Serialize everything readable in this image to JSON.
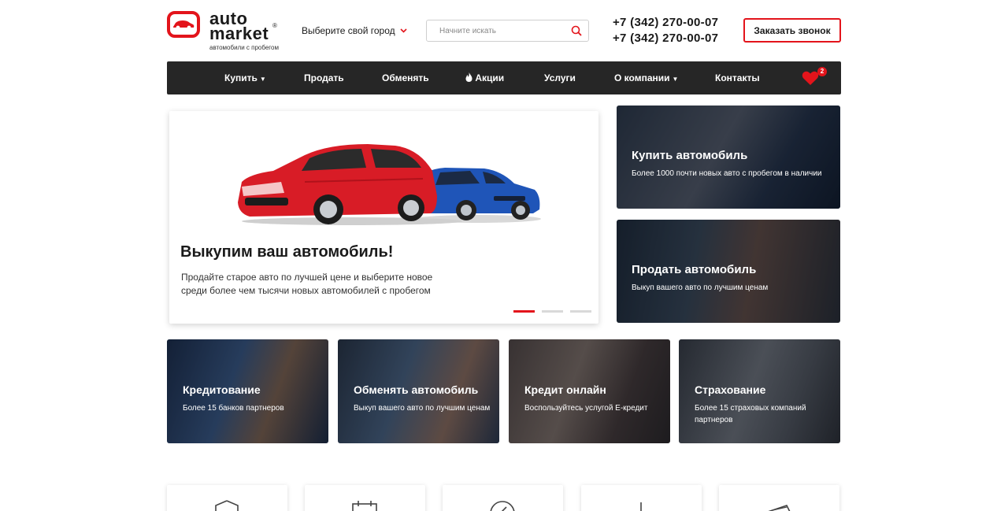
{
  "header": {
    "logo_line1": "auto",
    "logo_line2": "market",
    "logo_reg": "®",
    "tagline": "автомобили с пробегом",
    "city_label": "Выберите свой город",
    "search_placeholder": "Начните искать",
    "phone1": "+7 (342) 270-00-07",
    "phone2": "+7 (342) 270-00-07",
    "callback_label": "Заказать звонок"
  },
  "nav": {
    "items": [
      {
        "label": "Купить"
      },
      {
        "label": "Продать"
      },
      {
        "label": "Обменять"
      },
      {
        "label": "Акции"
      },
      {
        "label": "Услуги"
      },
      {
        "label": "О компании"
      },
      {
        "label": "Контакты"
      }
    ],
    "favorites_count": "2"
  },
  "slider": {
    "title": "Выкупим ваш автомобиль!",
    "description": "Продайте старое авто по лучшей цене и выберите новое среди более чем тысячи новых автомобилей с пробегом",
    "slides_count": 3,
    "active_slide": 1
  },
  "cards": {
    "buy": {
      "title": "Купить автомобиль",
      "subtitle": "Более 1000 почти новых авто с пробегом в наличии"
    },
    "sell": {
      "title": "Продать автомобиль",
      "subtitle": "Выкуп вашего авто по лучшим ценам"
    },
    "credit": {
      "title": "Кредитование",
      "subtitle": "Более 15 банков партнеров"
    },
    "exchange": {
      "title": "Обменять автомобиль",
      "subtitle": "Выкуп вашего авто по лучшим ценам"
    },
    "online_credit": {
      "title": "Кредит онлайн",
      "subtitle": "Воспользуйтесь услугой Е-кредит"
    },
    "insurance": {
      "title": "Страхование",
      "subtitle": "Более 15 страховых компаний партнеров"
    }
  },
  "colors": {
    "accent": "#e3141b",
    "nav_bg": "#262626"
  }
}
